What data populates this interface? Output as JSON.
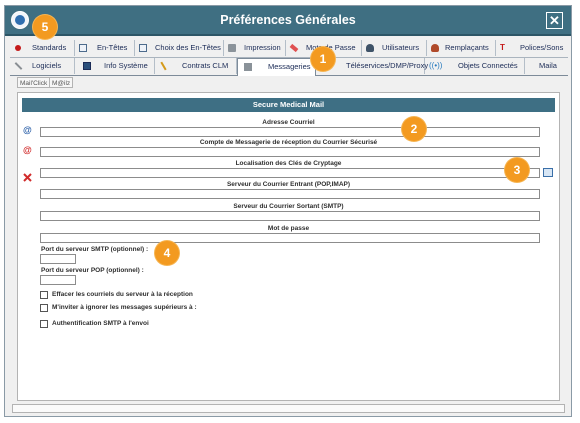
{
  "window": {
    "title": "Préférences Générales",
    "close_symbol": "✕"
  },
  "tabs_row1": [
    {
      "label": "Standards",
      "icon": "red-dot-icon"
    },
    {
      "label": "En-Têtes",
      "icon": "document-icon"
    },
    {
      "label": "Choix des En-Têtes",
      "icon": "document-icon"
    },
    {
      "label": "Impression",
      "icon": "printer-icon"
    },
    {
      "label": "Mots de Passe",
      "icon": "ribbon-icon"
    },
    {
      "label": "Utilisateurs",
      "icon": "user-icon"
    },
    {
      "label": "Remplaçants",
      "icon": "users-icon"
    },
    {
      "label": "Polices/Sons",
      "icon": "font-icon"
    }
  ],
  "tabs_row2": [
    {
      "label": "Logiciels",
      "icon": "wrench-icon"
    },
    {
      "label": "Info Système",
      "icon": "system-icon"
    },
    {
      "label": "Contrats CLM",
      "icon": "pencil-icon"
    },
    {
      "label": "Messageries",
      "icon": "envelope-icon",
      "active": true
    },
    {
      "label": "Téléservices/DMP/Proxy",
      "icon": ""
    },
    {
      "label": "Objets Connectés",
      "icon": "connected-icon",
      "glyph": "((•))"
    },
    {
      "label": "Maila",
      "icon": ""
    }
  ],
  "mail_tabs": [
    "Mail'Click",
    "M@ilz"
  ],
  "panel": {
    "header": "Secure Medical Mail",
    "fields": {
      "email_address": {
        "label": "Adresse Courriel",
        "value": ""
      },
      "account": {
        "label": "Compte de Messagerie de réception du Courrier Sécurisé",
        "value": ""
      },
      "key_location": {
        "label": "Localisation des Clés de Cryptage",
        "value": ""
      },
      "incoming_server": {
        "label": "Serveur du Courrier Entrant (POP,IMAP)",
        "value": ""
      },
      "outgoing_server": {
        "label": "Serveur du Courrier Sortant (SMTP)",
        "value": ""
      },
      "password": {
        "label": "Mot de passe",
        "value": ""
      },
      "smtp_port": {
        "label": "Port du serveur SMTP (optionnel) :",
        "value": ""
      },
      "pop_port": {
        "label": "Port du serveur POP (optionnel) :",
        "value": ""
      }
    },
    "at_glyph": "@",
    "checkboxes": [
      {
        "label": "Effacer les courriels du serveur à la réception",
        "checked": false
      },
      {
        "label": "M'inviter à ignorer les messages supérieurs à :",
        "checked": false
      },
      {
        "label": "Authentification SMTP à l'envoi",
        "checked": false
      }
    ]
  },
  "callouts": [
    "1",
    "2",
    "3",
    "4",
    "5"
  ],
  "colors": {
    "titlebar": "#3f6f82",
    "panel_header": "#3e6f84",
    "callout": "#f39a20"
  }
}
